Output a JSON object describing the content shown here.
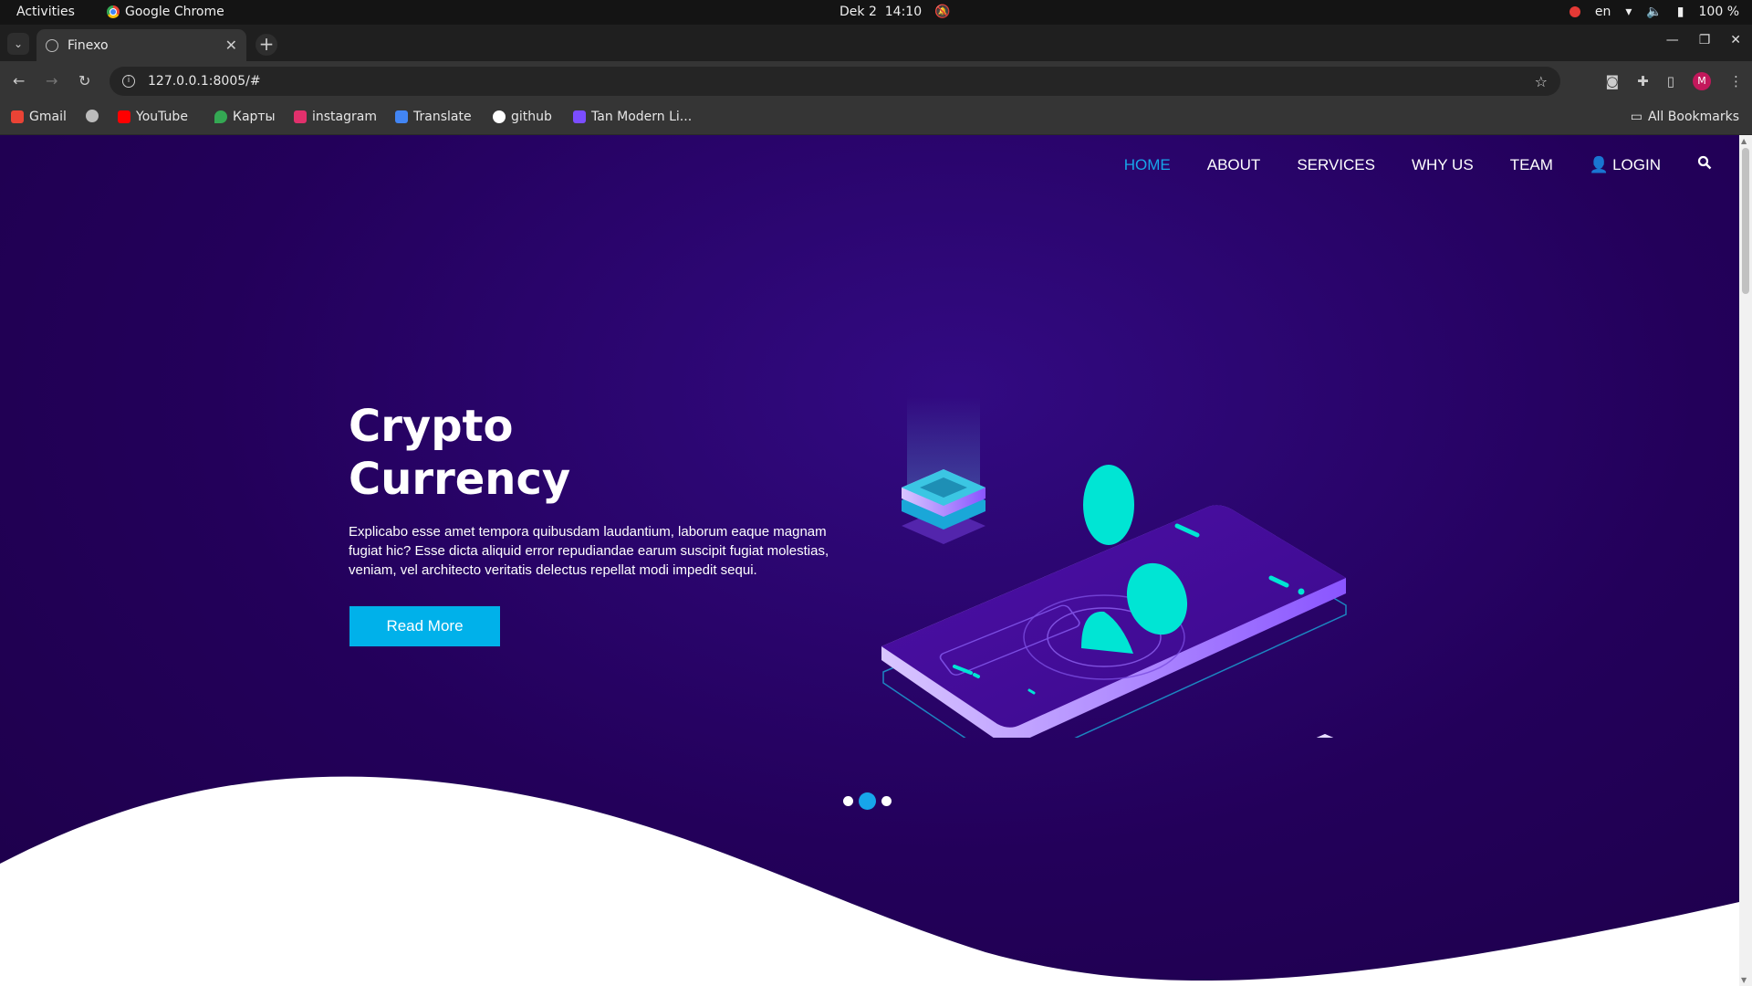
{
  "os_bar": {
    "activities": "Activities",
    "app_name": "Google Chrome",
    "date": "Dek 2",
    "time": "14:10",
    "lang": "en",
    "battery": "100 %"
  },
  "browser": {
    "tab_title": "Finexo",
    "url": "127.0.0.1:8005/#",
    "bookmarks": [
      {
        "label": "Gmail",
        "color": "#ea4335"
      },
      {
        "label": "",
        "color": "#bbbbbb"
      },
      {
        "label": "YouTube",
        "color": "#ff0000"
      },
      {
        "label": "Карты",
        "color": "#34a853"
      },
      {
        "label": "instagram",
        "color": "#e1306c"
      },
      {
        "label": "Translate",
        "color": "#4285f4"
      },
      {
        "label": "github",
        "color": "#ffffff"
      },
      {
        "label": "Tan Modern Li...",
        "color": "#7b4dff"
      }
    ],
    "all_bookmarks": "All Bookmarks",
    "avatar_letter": "M"
  },
  "site": {
    "nav": [
      "HOME",
      "ABOUT",
      "SERVICES",
      "WHY US",
      "TEAM",
      "LOGIN"
    ],
    "hero": {
      "title_line1": "Crypto",
      "title_line2": "Currency",
      "text": "Explicabo esse amet tempora quibusdam laudantium, laborum eaque magnam fugiat hic? Esse dicta aliquid error repudiandae earum suscipit fugiat molestias, veniam, vel architecto veritatis delectus repellat modi impedit sequi.",
      "button": "Read More"
    },
    "carousel": {
      "slides": 3,
      "active": 2
    },
    "colors": {
      "accent": "#00b1ea",
      "bg": "#23005a",
      "coin": "#00e5d4"
    }
  }
}
